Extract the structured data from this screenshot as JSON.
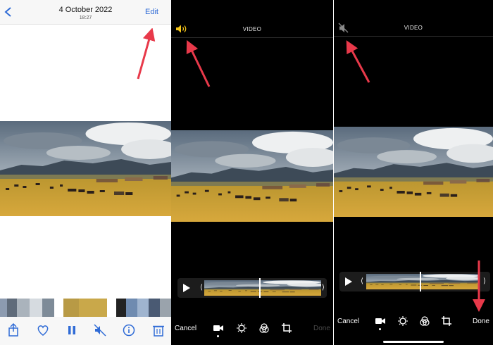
{
  "panel1": {
    "header": {
      "back_icon": "chevron-left-icon",
      "date": "4 October 2022",
      "time": "18:27",
      "edit_label": "Edit"
    },
    "toolbar_icons": [
      "share-icon",
      "heart-icon",
      "pause-icon",
      "speaker-muted-icon",
      "info-icon",
      "trash-icon"
    ]
  },
  "panel2": {
    "title": "VIDEO",
    "speaker_state": "on",
    "cancel_label": "Cancel",
    "done_label": "Done"
  },
  "panel3": {
    "title": "VIDEO",
    "speaker_state": "muted",
    "cancel_label": "Cancel",
    "done_label": "Done"
  },
  "colors": {
    "accent_blue": "#2f6bd6",
    "speaker_yellow": "#f5c518",
    "arrow_red": "#e8394a",
    "done_dim": "#4a4a4a"
  }
}
